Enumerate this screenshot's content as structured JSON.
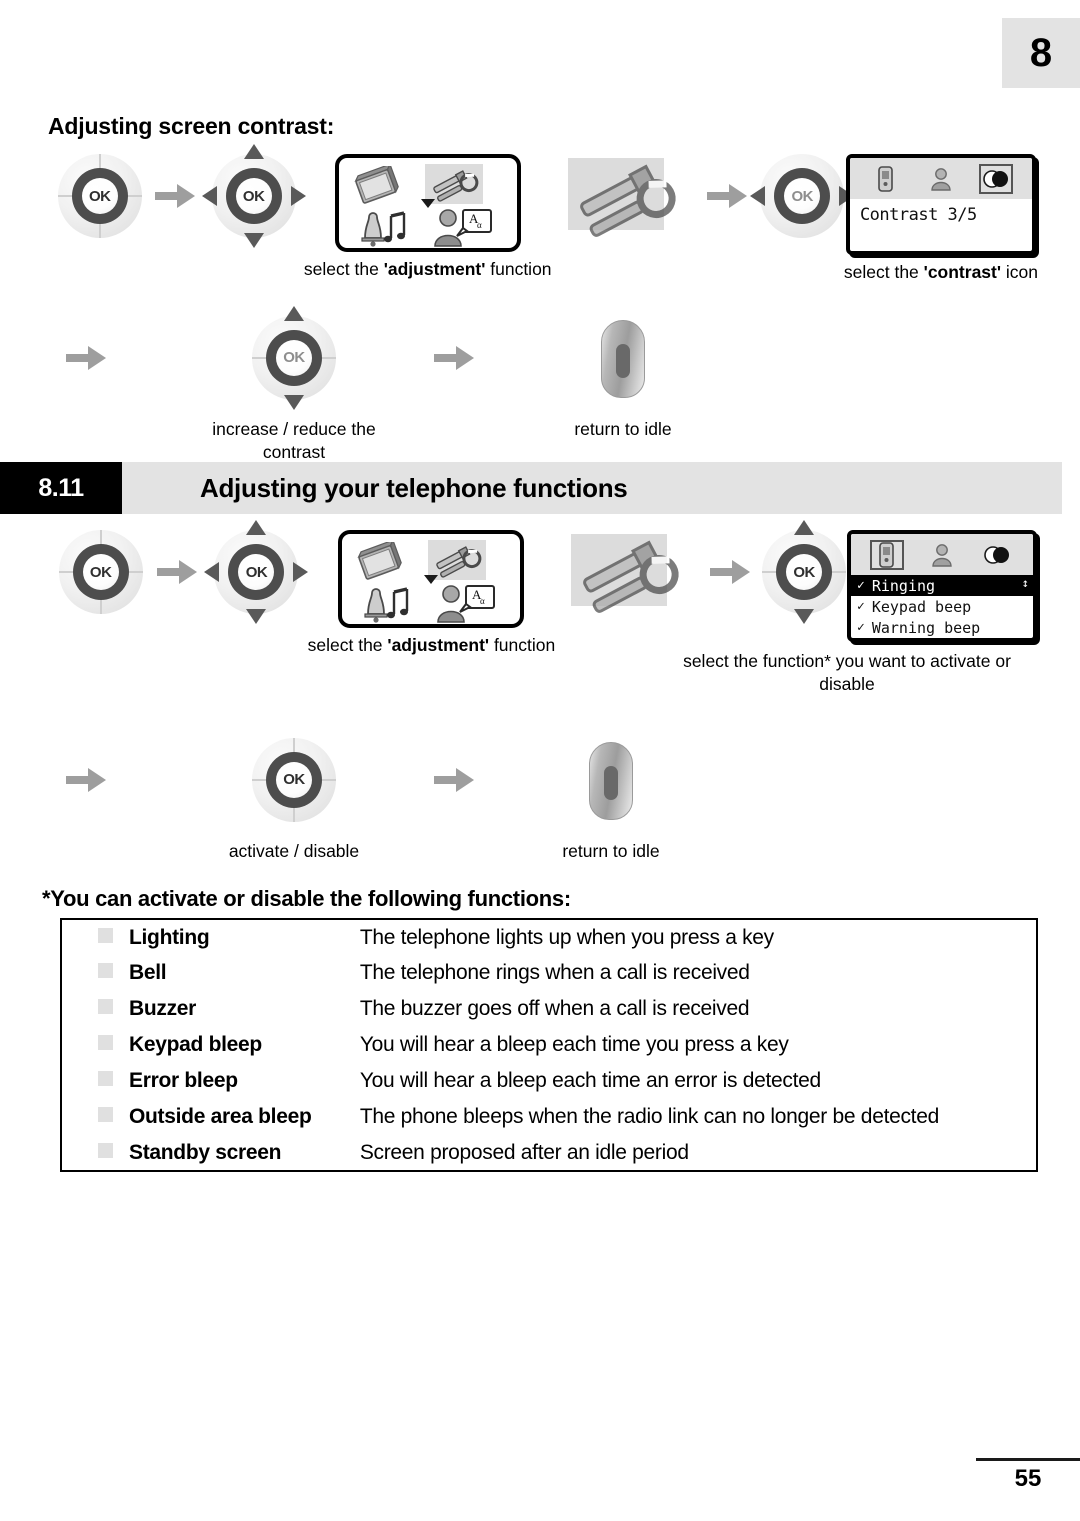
{
  "chapter": {
    "number": "8"
  },
  "heading": {
    "contrast_section": "Adjusting screen contrast:"
  },
  "keys": {
    "ok_label": "OK"
  },
  "contrast_flow": {
    "captions": {
      "adjustment_prefix": "select the ",
      "adjustment_bold": "'adjustment'",
      "adjustment_suffix": " function",
      "contrast_prefix": "select the ",
      "contrast_bold": "'contrast'",
      "contrast_suffix": " icon",
      "increase_reduce": "increase / reduce the contrast",
      "return_idle": "return to idle"
    },
    "screen": {
      "text": "Contrast 3/5",
      "value": "3/5",
      "icons": [
        "handset-icon",
        "person-icon",
        "contrast-icon"
      ],
      "selected_icon": "contrast-icon"
    }
  },
  "section": {
    "number": "8.11",
    "title": "Adjusting your telephone functions"
  },
  "functions_flow": {
    "captions": {
      "adjustment_prefix": "select the ",
      "adjustment_bold": "'adjustment'",
      "adjustment_suffix": " function",
      "select_function": "select the function* you want to activate or disable",
      "activate_disable": "activate / disable",
      "return_idle": "return to idle"
    },
    "screen": {
      "icons": [
        "handset-icon",
        "person-icon",
        "contrast-icon"
      ],
      "selected_icon": "handset-icon",
      "items": [
        {
          "label": "Ringing",
          "checked": "✓",
          "active": true
        },
        {
          "label": "Keypad beep",
          "checked": "✓",
          "active": false
        },
        {
          "label": "Warning beep",
          "checked": "✓",
          "active": false
        }
      ],
      "scroll_indicator": "↕"
    }
  },
  "functions_table": {
    "heading": "*You can activate or disable the following functions:",
    "rows": [
      {
        "name": "Lighting",
        "description": "The telephone lights up when you press a key"
      },
      {
        "name": "Bell",
        "description": "The telephone rings when a call is received"
      },
      {
        "name": "Buzzer",
        "description": "The buzzer goes off when a call is received"
      },
      {
        "name": "Keypad bleep",
        "description": "You will hear a bleep each time you press a key"
      },
      {
        "name": "Error bleep",
        "description": "You will hear a bleep each time an error is detected"
      },
      {
        "name": "Outside area bleep",
        "description": "The phone bleeps when the radio link can no longer be detected"
      },
      {
        "name": "Standby screen",
        "description": "Screen proposed after an idle period"
      }
    ]
  },
  "footer": {
    "page_number": "55"
  },
  "colors": {
    "badge_bg": "#e3e3e3",
    "section_bar_bg": "#e3e3e3",
    "section_num_bg": "#000000",
    "arrow_grey": "#9e9e9e",
    "key_ring": "#4d4d4d",
    "bullet": "#e0e0e0"
  }
}
